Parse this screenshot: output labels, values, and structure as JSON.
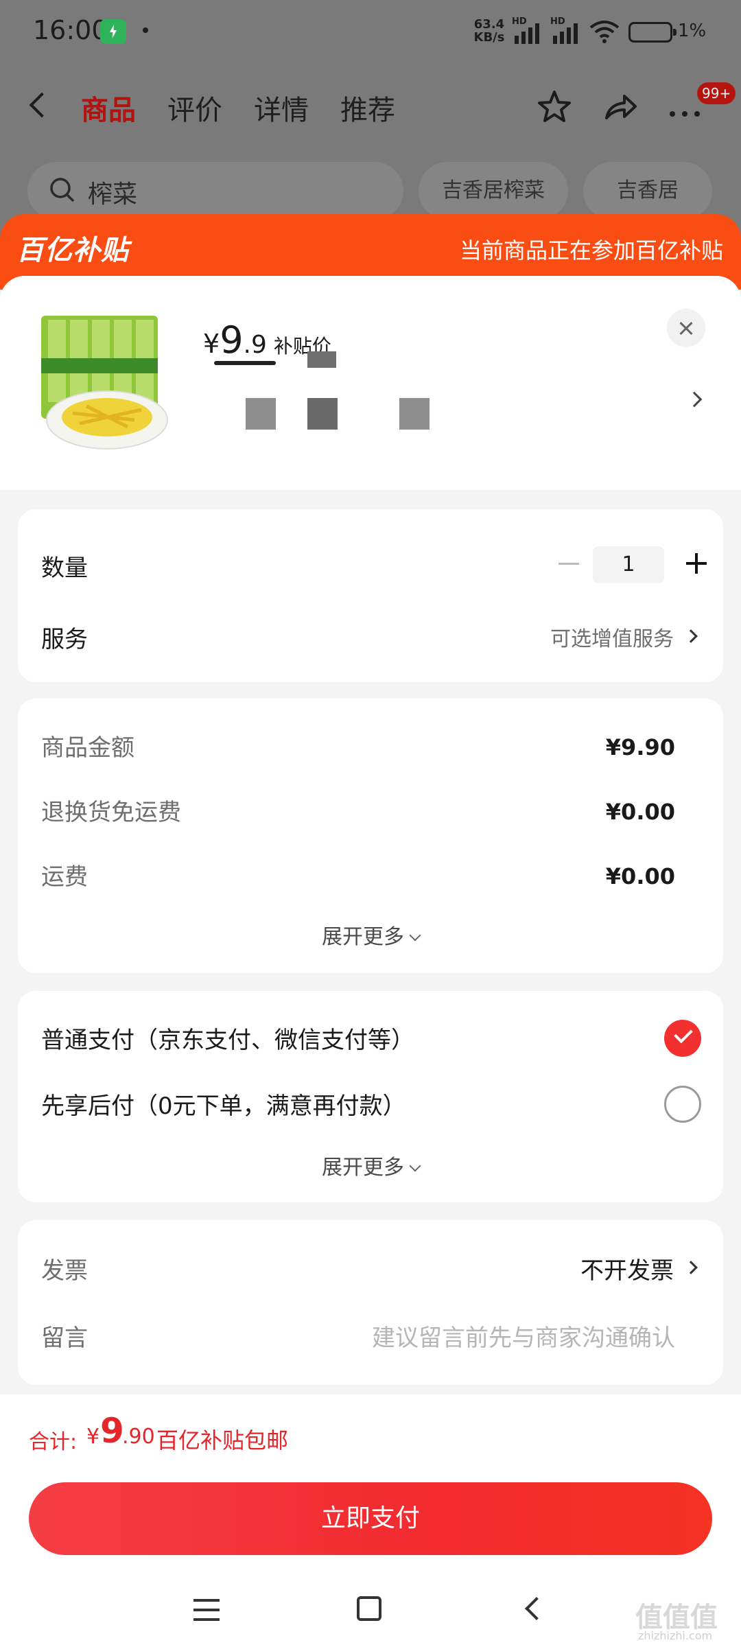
{
  "status_bar": {
    "time": "16:00",
    "speed_value": "63.4",
    "speed_unit": "KB/s",
    "hd_label": "HD",
    "battery": "1%"
  },
  "top_nav": {
    "tabs": [
      {
        "label": "商品",
        "active": true
      },
      {
        "label": "评价",
        "active": false
      },
      {
        "label": "详情",
        "active": false
      },
      {
        "label": "推荐",
        "active": false
      }
    ],
    "badge": "99+"
  },
  "search": {
    "query": "榨菜",
    "chips": [
      "吉香居榨菜",
      "吉香居"
    ]
  },
  "banner": {
    "logo": "百亿补贴",
    "text": "当前商品正在参加百亿补贴"
  },
  "product": {
    "currency": "¥",
    "price_int": "9",
    "price_dec": ".9",
    "price_tag": "补贴价"
  },
  "quantity": {
    "label": "数量",
    "value": "1"
  },
  "service": {
    "label": "服务",
    "value": "可选增值服务"
  },
  "amounts": {
    "rows": [
      {
        "label": "商品金额",
        "value": "¥9.90"
      },
      {
        "label": "退换货免运费",
        "value": "¥0.00"
      },
      {
        "label": "运费",
        "value": "¥0.00"
      }
    ],
    "expand": "展开更多"
  },
  "payment": {
    "options": [
      {
        "label": "普通支付（京东支付、微信支付等）",
        "selected": true
      },
      {
        "label": "先享后付（0元下单，满意再付款）",
        "selected": false
      }
    ],
    "expand": "展开更多"
  },
  "invoice": {
    "label": "发票",
    "value": "不开发票"
  },
  "message": {
    "label": "留言",
    "placeholder": "建议留言前先与商家沟通确认"
  },
  "total": {
    "label": "合计:",
    "currency": "¥",
    "int": "9",
    "dec": ".90",
    "note": "百亿补贴包邮"
  },
  "pay_button": "立即支付",
  "watermark": "值值值",
  "watermark_sub": "zhizhizhi.com",
  "colors": {
    "accent_orange": "#fa4d13",
    "primary_red": "#f23030",
    "total_red": "#e4262b"
  }
}
